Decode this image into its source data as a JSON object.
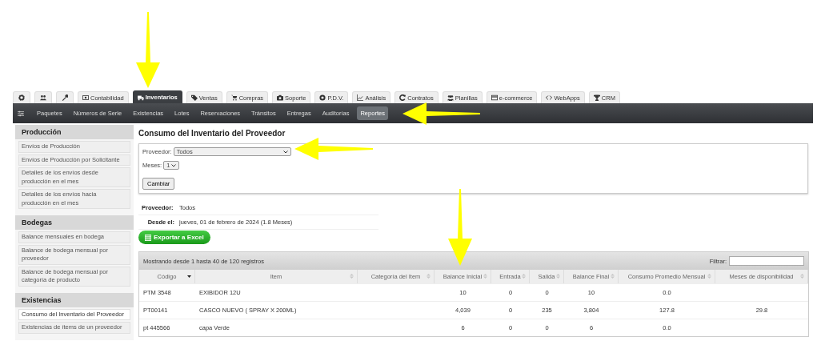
{
  "tabs": [
    {
      "selected": false
    },
    {
      "selected": false
    },
    {
      "selected": false
    },
    {
      "label": "Contabilidad",
      "selected": false
    },
    {
      "label": "Inventarios",
      "selected": true
    },
    {
      "label": "Ventas",
      "selected": false
    },
    {
      "label": "Compras",
      "selected": false
    },
    {
      "label": "Soporte",
      "selected": false
    },
    {
      "label": "P.D.V.",
      "selected": false
    },
    {
      "label": "Análisis",
      "selected": false
    },
    {
      "label": "Contratos",
      "selected": false
    },
    {
      "label": "Planillas",
      "selected": false
    },
    {
      "label": "e-commerce",
      "selected": false
    },
    {
      "label": "WebApps",
      "selected": false
    },
    {
      "label": "CRM",
      "selected": false
    }
  ],
  "subnav": [
    {
      "label": "Paquetes",
      "selected": false
    },
    {
      "label": "Números de Serie",
      "selected": false
    },
    {
      "label": "Existencias",
      "selected": false
    },
    {
      "label": "Lotes",
      "selected": false
    },
    {
      "label": "Reservaciones",
      "selected": false
    },
    {
      "label": "Tránsitos",
      "selected": false
    },
    {
      "label": "Entregas",
      "selected": false
    },
    {
      "label": "Auditorías",
      "selected": false
    },
    {
      "label": "Reportes",
      "selected": true
    }
  ],
  "sidebar": [
    {
      "title": "Producción",
      "items": [
        {
          "label": "Envíos de Producción",
          "selected": false
        },
        {
          "label": "Envíos de Producción por Solicitante",
          "selected": false
        },
        {
          "label": "Detalles de los envíos desde producción en el mes",
          "selected": false
        },
        {
          "label": "Detalles de los envíos hacia producción en el mes",
          "selected": false
        }
      ]
    },
    {
      "title": "Bodegas",
      "items": [
        {
          "label": "Balance mensuales en bodega",
          "selected": false
        },
        {
          "label": "Balance de bodega mensual por proveedor",
          "selected": false
        },
        {
          "label": "Balance de bodega mensual por categoría de producto",
          "selected": false
        }
      ]
    },
    {
      "title": "Existencias",
      "items": [
        {
          "label": "Consumo del Inventario del Proveedor",
          "selected": true
        },
        {
          "label": "Existencias de ítems de un proveedor",
          "selected": false
        }
      ]
    }
  ],
  "page_title": "Consumo del Inventario del Proveedor",
  "form": {
    "proveedor_label": "Proveedor:",
    "proveedor_value": "Todos",
    "meses_label": "Meses:",
    "meses_value": "1",
    "submit": "Cambiar"
  },
  "summary": [
    {
      "label": "Proveedor:",
      "value": "Todos"
    },
    {
      "label": "Desde el:",
      "value": "jueves, 01 de febrero de 2024 (1.8 Meses)"
    }
  ],
  "export_button": "Exportar a Excel",
  "table": {
    "info": "Mostrando desde 1 hasta 40 de 120 registros",
    "filter_label": "Filtrar:",
    "columns": [
      {
        "label": "Código",
        "sorted": true
      },
      {
        "label": "Item",
        "sorted": false
      },
      {
        "label": "Categoría del Item",
        "sorted": false
      },
      {
        "label": "Balance Inicial",
        "sorted": false
      },
      {
        "label": "Entrada",
        "sorted": false
      },
      {
        "label": "Salida",
        "sorted": false
      },
      {
        "label": "Balance Final",
        "sorted": false
      },
      {
        "label": "Consumo Promedio Mensual",
        "sorted": false
      },
      {
        "label": "Meses de disponibilidad",
        "sorted": false
      }
    ],
    "rows": [
      [
        "PTM 3548",
        "EXIBIDOR 12U",
        "",
        "10",
        "0",
        "0",
        "10",
        "0.0",
        ""
      ],
      [
        "PT00141",
        "CASCO NUEVO ( SPRAY X 200ML)",
        "",
        "4,039",
        "0",
        "235",
        "3,804",
        "127.8",
        "29.8"
      ],
      [
        "pt 445566",
        "capa Verde",
        "",
        "6",
        "0",
        "0",
        "6",
        "0.0",
        ""
      ]
    ]
  }
}
